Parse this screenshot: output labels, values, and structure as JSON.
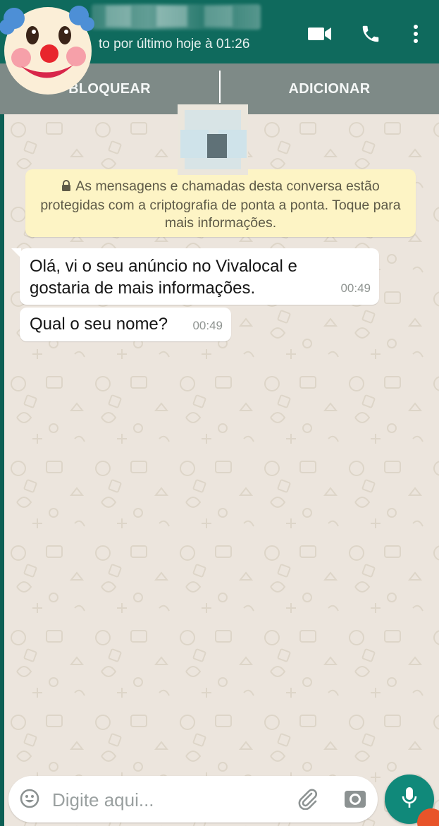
{
  "header": {
    "last_seen": "visto por último hoje à 01:26",
    "last_seen_visible": "to por último hoje à 01:26",
    "icons": [
      "video-call-icon",
      "phone-call-icon",
      "more-vert-icon"
    ]
  },
  "actions": {
    "block_label": "BLOQUEAR",
    "add_label": "ADICIONAR"
  },
  "encryption_notice": "As mensagens e chamadas desta conversa estão protegidas com a criptografia de ponta a ponta. Toque para mais informações.",
  "messages": [
    {
      "text": "Olá, vi o seu anúncio no Vivalocal e gostaria de mais informações.",
      "time": "00:49"
    },
    {
      "text": "Qual o seu nome?",
      "time": "00:49"
    }
  ],
  "composer": {
    "placeholder": "Digite aqui..."
  },
  "colors": {
    "header": "#0f6a5d",
    "chat_background": "#ece5dd",
    "notice_background": "#fdf4c5",
    "mic_button": "#10897a"
  }
}
